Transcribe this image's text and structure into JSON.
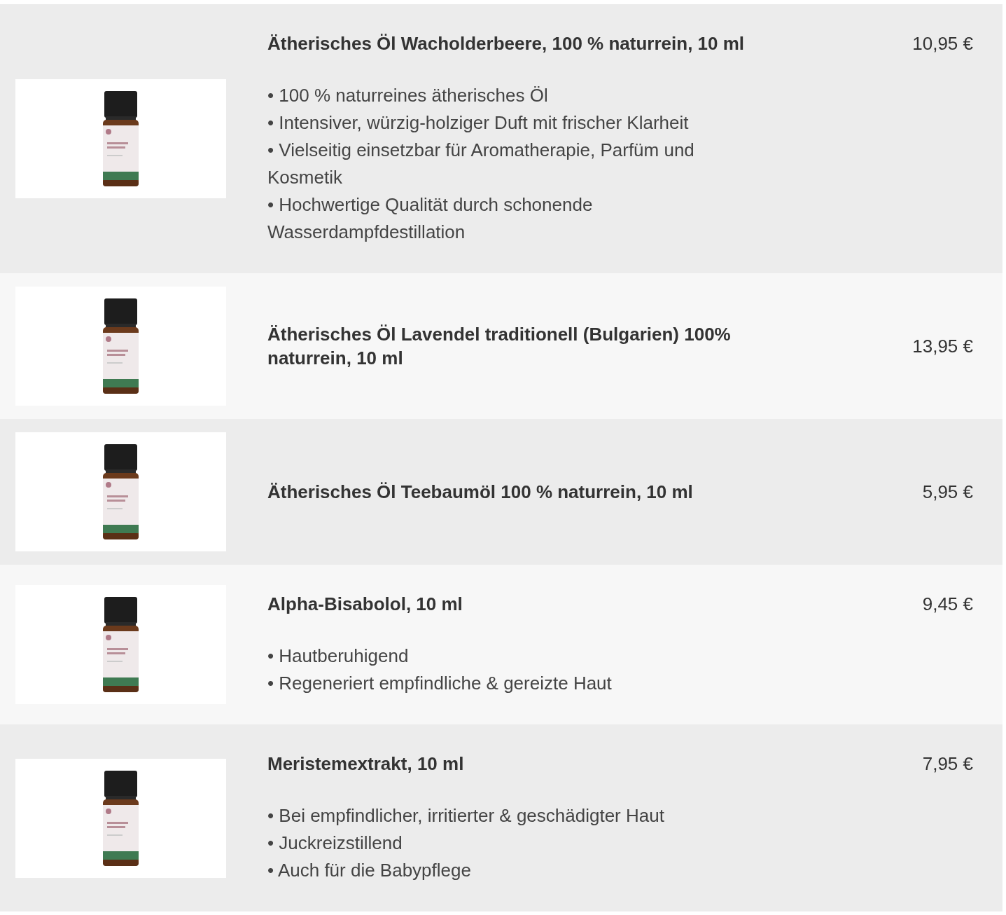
{
  "products": [
    {
      "image": {
        "kind": "picture"
      },
      "title": "Ätherisches Öl Wacholderbeere, 100 % naturrein, 10 ml",
      "price": "10,95 €",
      "bullets": [
        "• 100 % naturreines ätherisches Öl",
        "• Intensiver, würzig-holziger Duft mit frischer Klarheit",
        "• Vielseitig einsetzbar für Aromatherapie, Parfüm und Kosmetik",
        "• Hochwertige Qualität durch schonende Wasserdampfdestillation"
      ]
    },
    {
      "image": {
        "kind": "picture"
      },
      "title": "Ätherisches Öl Lavendel traditionell (Bulgarien) 100% naturrein, 10 ml",
      "price": "13,95 €"
    },
    {
      "image": {
        "kind": "picture"
      },
      "title": "Ätherisches Öl Teebaumöl 100 % naturrein, 10 ml",
      "price": "5,95 €"
    },
    {
      "image": {
        "kind": "picture"
      },
      "title": "Alpha-Bisabolol, 10 ml",
      "price": "9,45 €",
      "bullets": [
        "• Hautberuhigend",
        "• Regeneriert empfindliche & gereizte Haut"
      ]
    },
    {
      "image": {
        "kind": "picture"
      },
      "title": "Meristemextrakt, 10 ml",
      "price": "7,95 €",
      "bullets": [
        "• Bei empfindlicher, irritierter & geschädigter Haut",
        "• Juckreizstillend",
        "• Auch für die Babypflege"
      ]
    }
  ]
}
